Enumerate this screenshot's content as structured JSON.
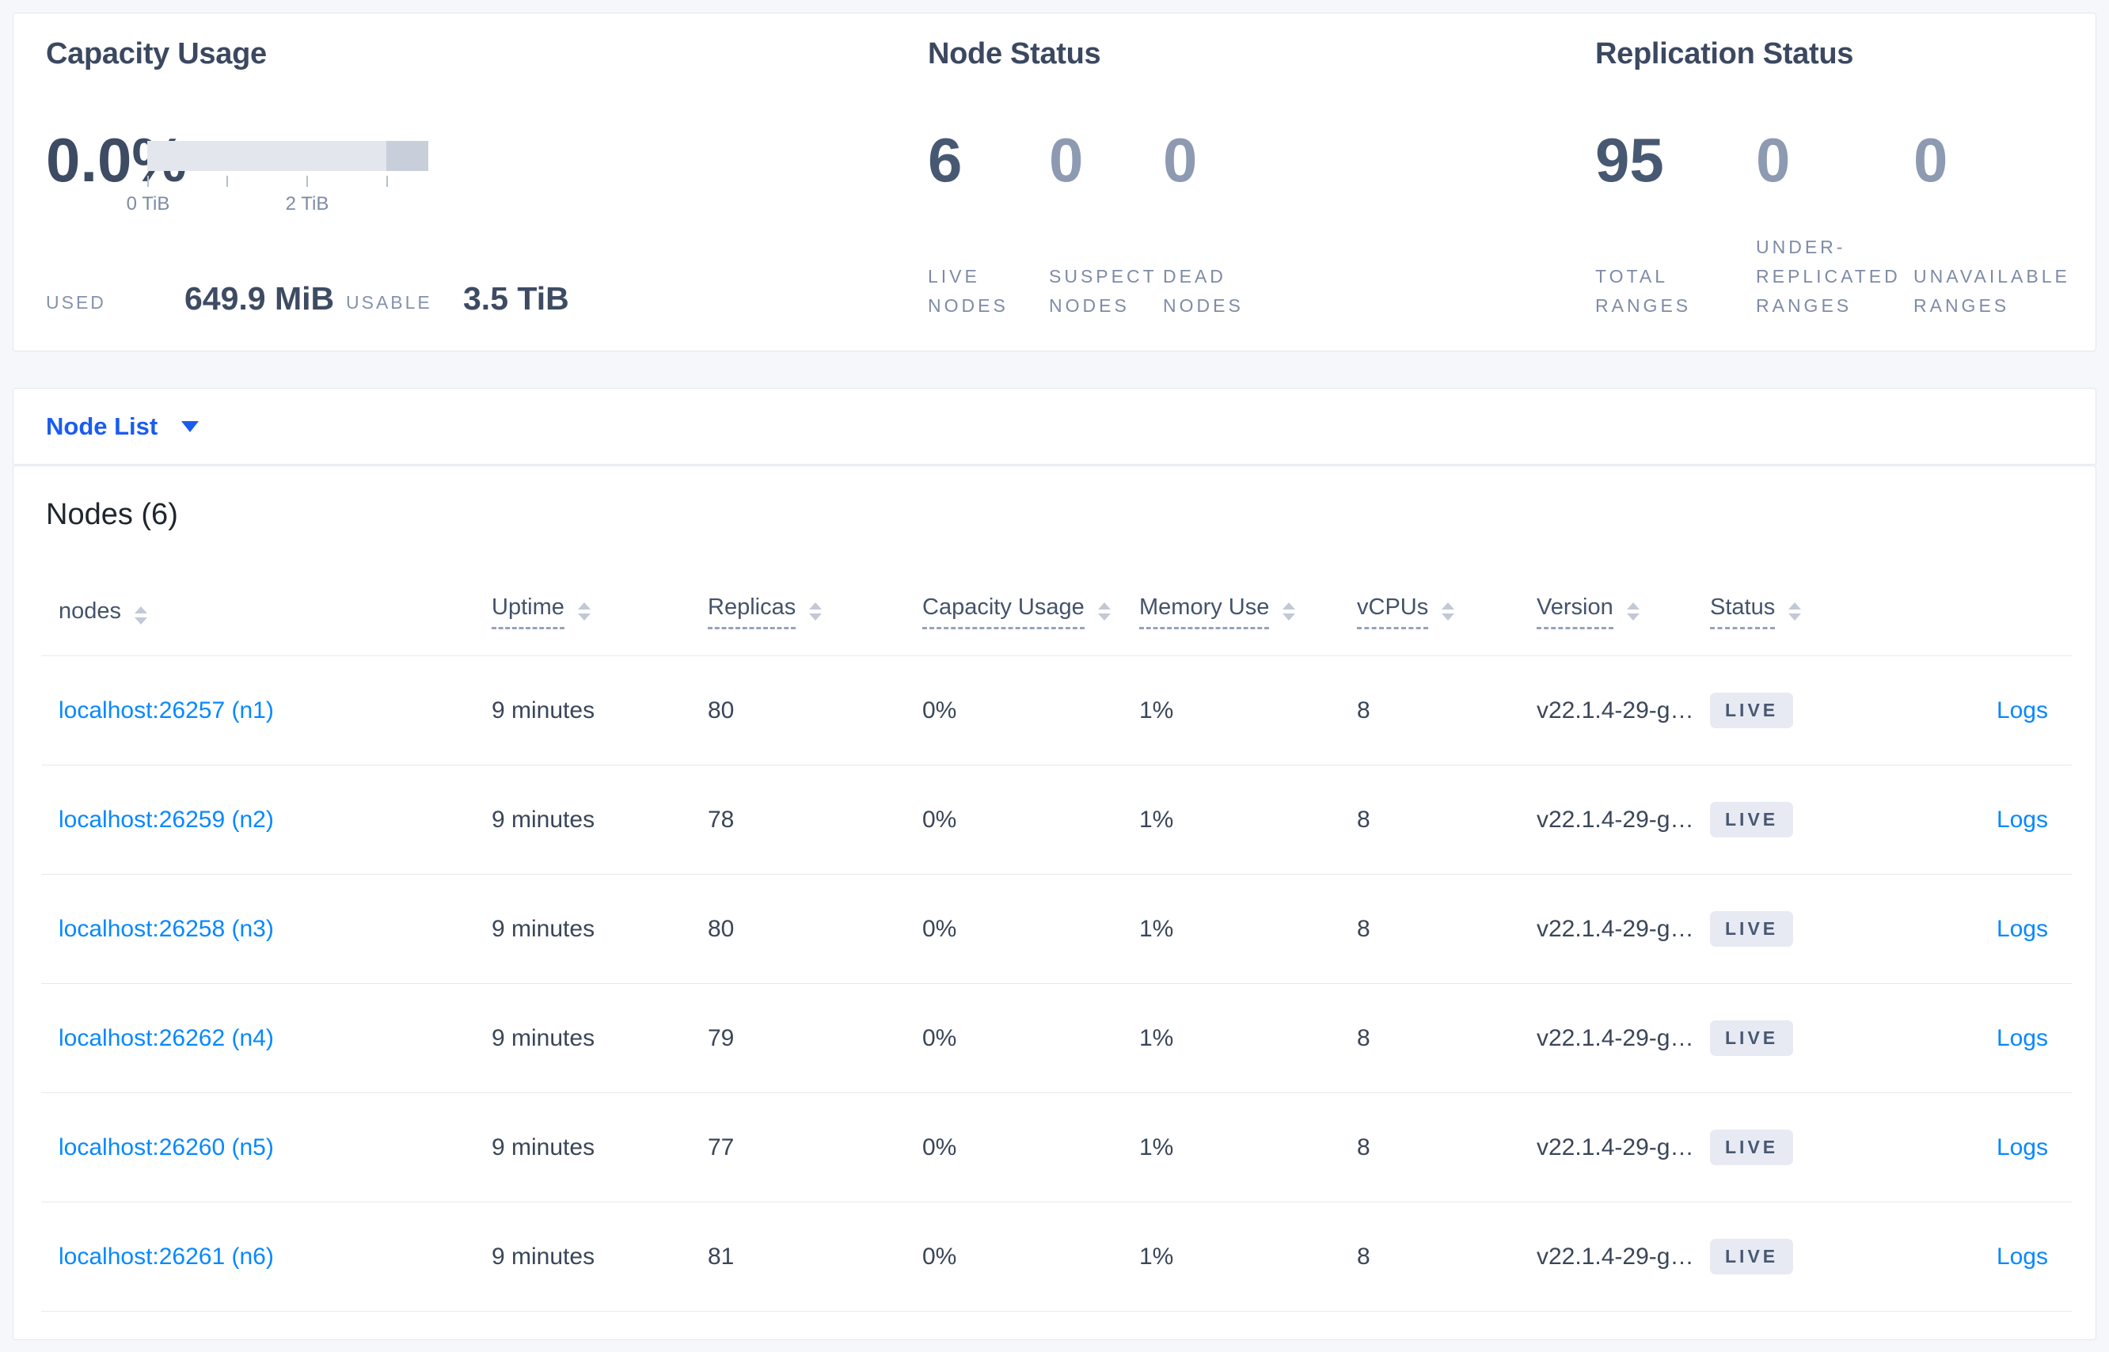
{
  "capacity": {
    "title": "Capacity Usage",
    "percent": "0.0%",
    "tick_labels": [
      "0 TiB",
      "2 TiB"
    ],
    "used_label": "USED",
    "used_value": "649.9 MiB",
    "usable_label": "USABLE",
    "usable_value": "3.5 TiB"
  },
  "node_status": {
    "title": "Node Status",
    "stats": [
      {
        "value": "6",
        "label_lines": [
          "LIVE",
          "NODES"
        ]
      },
      {
        "value": "0",
        "label_lines": [
          "SUSPECT",
          "NODES"
        ]
      },
      {
        "value": "0",
        "label_lines": [
          "DEAD",
          "NODES"
        ]
      }
    ]
  },
  "replication_status": {
    "title": "Replication Status",
    "stats": [
      {
        "value": "95",
        "label_lines": [
          "TOTAL",
          "RANGES"
        ]
      },
      {
        "value": "0",
        "label_lines": [
          "UNDER-",
          "REPLICATED",
          "RANGES"
        ]
      },
      {
        "value": "0",
        "label_lines": [
          "UNAVAILABLE",
          "RANGES"
        ]
      }
    ]
  },
  "node_list_dropdown": {
    "label": "Node List"
  },
  "nodes_table": {
    "title": "Nodes (6)",
    "columns": [
      "nodes",
      "Uptime",
      "Replicas",
      "Capacity Usage",
      "Memory Use",
      "vCPUs",
      "Version",
      "Status"
    ],
    "rows": [
      {
        "node": "localhost:26257 (n1)",
        "uptime": "9 minutes",
        "replicas": "80",
        "capacity_usage": "0%",
        "memory_use": "1%",
        "vcpus": "8",
        "version": "v22.1.4-29-g…",
        "status": "LIVE",
        "logs": "Logs"
      },
      {
        "node": "localhost:26259 (n2)",
        "uptime": "9 minutes",
        "replicas": "78",
        "capacity_usage": "0%",
        "memory_use": "1%",
        "vcpus": "8",
        "version": "v22.1.4-29-g…",
        "status": "LIVE",
        "logs": "Logs"
      },
      {
        "node": "localhost:26258 (n3)",
        "uptime": "9 minutes",
        "replicas": "80",
        "capacity_usage": "0%",
        "memory_use": "1%",
        "vcpus": "8",
        "version": "v22.1.4-29-g…",
        "status": "LIVE",
        "logs": "Logs"
      },
      {
        "node": "localhost:26262 (n4)",
        "uptime": "9 minutes",
        "replicas": "79",
        "capacity_usage": "0%",
        "memory_use": "1%",
        "vcpus": "8",
        "version": "v22.1.4-29-g…",
        "status": "LIVE",
        "logs": "Logs"
      },
      {
        "node": "localhost:26260 (n5)",
        "uptime": "9 minutes",
        "replicas": "77",
        "capacity_usage": "0%",
        "memory_use": "1%",
        "vcpus": "8",
        "version": "v22.1.4-29-g…",
        "status": "LIVE",
        "logs": "Logs"
      },
      {
        "node": "localhost:26261 (n6)",
        "uptime": "9 minutes",
        "replicas": "81",
        "capacity_usage": "0%",
        "memory_use": "1%",
        "vcpus": "8",
        "version": "v22.1.4-29-g…",
        "status": "LIVE",
        "logs": "Logs"
      }
    ]
  },
  "colors": {
    "accent_blue": "#1b5cf0",
    "link_blue": "#0788ff",
    "slate": "#475872",
    "badge_bg": "#e7eaf2"
  }
}
